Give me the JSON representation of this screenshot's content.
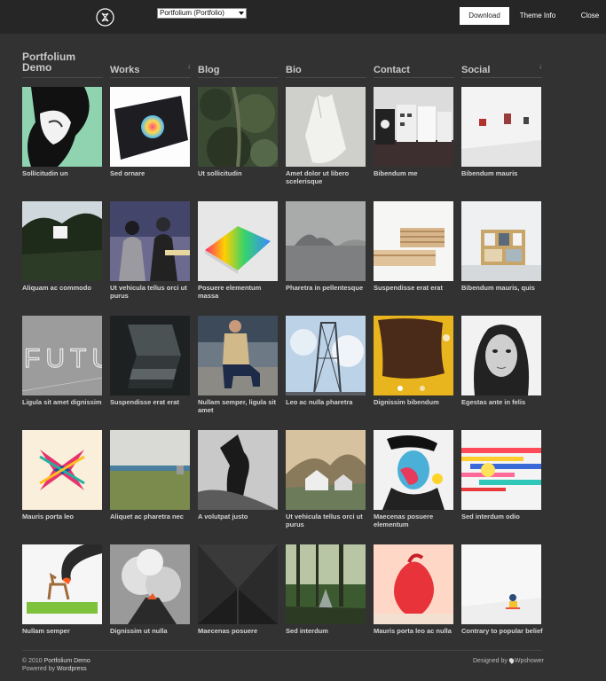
{
  "topbar": {
    "theme_select_value": "Portfolium (Portfolio)",
    "download_label": "Download",
    "theme_info_label": "Theme Info",
    "close_label": "Close"
  },
  "site": {
    "title_line1": "Portfolium",
    "title_line2": "Demo"
  },
  "nav": [
    {
      "label": "Works",
      "has_arrow": true
    },
    {
      "label": "Blog",
      "has_arrow": false
    },
    {
      "label": "Bio",
      "has_arrow": false
    },
    {
      "label": "Contact",
      "has_arrow": false
    },
    {
      "label": "Social",
      "has_arrow": true
    }
  ],
  "nav_arrow_glyph": "↓",
  "grid": [
    [
      {
        "caption": "Sollicitudin un",
        "img": "face-green"
      },
      {
        "caption": "Sed ornare",
        "img": "book-dark"
      },
      {
        "caption": "Ut sollicitudin",
        "img": "forest-aerial"
      },
      {
        "caption": "Amet dolor ut libero scelerisque",
        "img": "white-bag"
      },
      {
        "caption": "Bibendum me",
        "img": "brochures"
      },
      {
        "caption": "Bibendum mauris",
        "img": "gallery-wall"
      }
    ],
    [
      {
        "caption": "Aliquam ac commodo",
        "img": "house-forest"
      },
      {
        "caption": "Ut vehicula tellus orci ut purus",
        "img": "suits"
      },
      {
        "caption": "Posuere elementum massa",
        "img": "rainbow-book"
      },
      {
        "caption": "Pharetra in pellentesque",
        "img": "misty-sea"
      },
      {
        "caption": "Suspendisse erat erat",
        "img": "wood-bench"
      },
      {
        "caption": "Bibendum mauris, quis",
        "img": "shelf"
      }
    ],
    [
      {
        "caption": "Ligula sit amet dignissim",
        "img": "futu-text"
      },
      {
        "caption": "Suspendisse erat erat",
        "img": "stairs"
      },
      {
        "caption": "Nullam semper, ligula sit amet",
        "img": "man-sitting"
      },
      {
        "caption": "Leo ac nulla pharetra",
        "img": "tower-sky"
      },
      {
        "caption": "Dignissim bibendum",
        "img": "chocolate"
      },
      {
        "caption": "Egestas ante in felis",
        "img": "woman-portrait"
      }
    ],
    [
      {
        "caption": "Mauris porta leo",
        "img": "x-logo"
      },
      {
        "caption": "Aliquet ac pharetra nec",
        "img": "zipper"
      },
      {
        "caption": "A volutpat justo",
        "img": "shadow-figure"
      },
      {
        "caption": "Ut vehicula tellus orci ut purus",
        "img": "painting-house"
      },
      {
        "caption": "Maecenas posuere elementum",
        "img": "sailor-girl"
      },
      {
        "caption": "Sed interdum odio",
        "img": "abstract-stripes"
      }
    ],
    [
      {
        "caption": "Nullam semper",
        "img": "deer-fire"
      },
      {
        "caption": "Dignissim ut nulla",
        "img": "smoke-volcano"
      },
      {
        "caption": "Maecenas posuere",
        "img": "dark-fabric"
      },
      {
        "caption": "Sed interdum",
        "img": "forest-stream"
      },
      {
        "caption": "Mauris porta leo ac nulla",
        "img": "red-figure"
      },
      {
        "caption": "Contrary to popular belief",
        "img": "small-figure"
      }
    ]
  ],
  "footer": {
    "copyright": "© 2010",
    "site_name": "Portfolium Demo",
    "powered_prefix": "Powered by",
    "powered_name": "Wordpress",
    "designed_prefix": "Designed by",
    "designer_name": "Wpshower"
  }
}
